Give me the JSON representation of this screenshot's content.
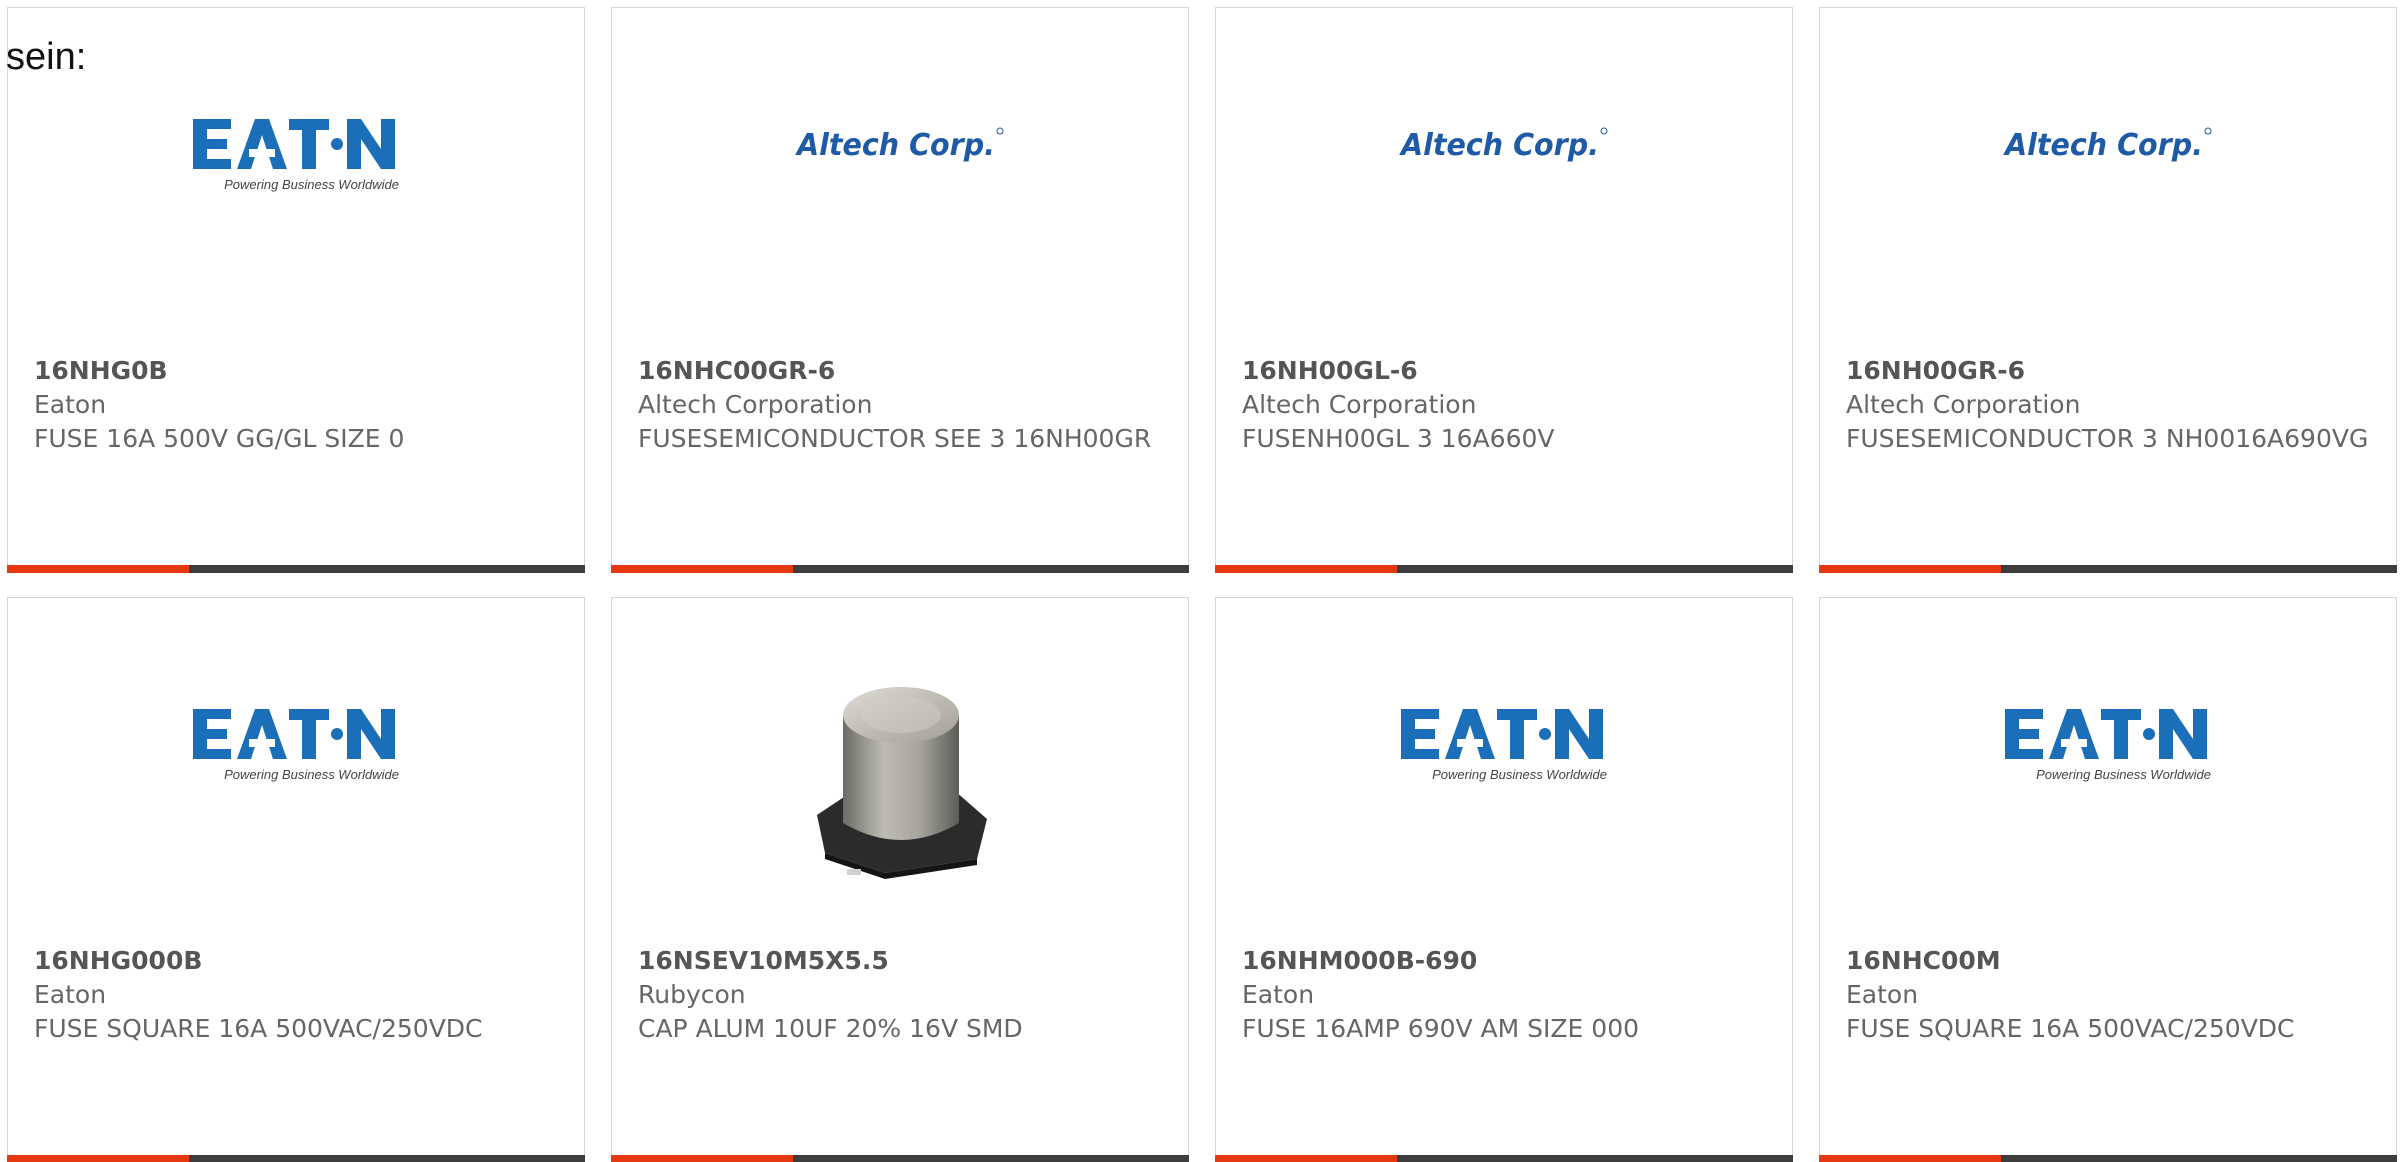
{
  "intro_text": "sein:",
  "colors": {
    "accent": "#e63912",
    "bar": "#3d3d3d",
    "eaton_blue": "#1a6fb8",
    "altech_blue": "#1f5aa6"
  },
  "products": [
    {
      "image": "eaton-logo",
      "logo_name": "E·T·N",
      "logo_tagline": "Powering Business Worldwide",
      "part_number": "16NHG0B",
      "manufacturer": "Eaton",
      "description": "FUSE 16A 500V GG/GL SIZE 0"
    },
    {
      "image": "altech-logo",
      "logo_name": "Altech Corp.",
      "part_number": "16NHC00GR-6",
      "manufacturer": "Altech Corporation",
      "description": "FUSESEMICONDUCTOR SEE 3 16NH00GR"
    },
    {
      "image": "altech-logo",
      "logo_name": "Altech Corp.",
      "part_number": "16NH00GL-6",
      "manufacturer": "Altech Corporation",
      "description": "FUSENH00GL 3 16A660V"
    },
    {
      "image": "altech-logo",
      "logo_name": "Altech Corp.",
      "part_number": "16NH00GR-6",
      "manufacturer": "Altech Corporation",
      "description": "FUSESEMICONDUCTOR 3 NH0016A690VG"
    },
    {
      "image": "eaton-logo",
      "logo_name": "E·T·N",
      "logo_tagline": "Powering Business Worldwide",
      "part_number": "16NHG000B",
      "manufacturer": "Eaton",
      "description": "FUSE SQUARE 16A 500VAC/250VDC"
    },
    {
      "image": "capacitor-photo",
      "part_number": "16NSEV10M5X5.5",
      "manufacturer": "Rubycon",
      "description": "CAP ALUM 10UF 20% 16V SMD"
    },
    {
      "image": "eaton-logo",
      "logo_name": "E·T·N",
      "logo_tagline": "Powering Business Worldwide",
      "part_number": "16NHM000B-690",
      "manufacturer": "Eaton",
      "description": "FUSE 16AMP 690V AM SIZE 000"
    },
    {
      "image": "eaton-logo",
      "logo_name": "E·T·N",
      "logo_tagline": "Powering Business Worldwide",
      "part_number": "16NHC00M",
      "manufacturer": "Eaton",
      "description": "FUSE SQUARE 16A 500VAC/250VDC"
    }
  ]
}
